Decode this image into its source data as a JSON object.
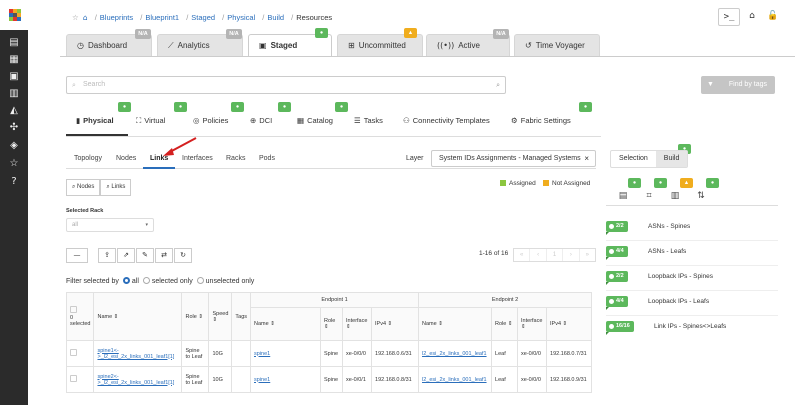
{
  "breadcrumb": [
    "Blueprints",
    "Blueprint1",
    "Staged",
    "Physical",
    "Build",
    "Resources"
  ],
  "top_buttons": {
    "terminal": ">_",
    "home": "⌂",
    "lock": "🔓"
  },
  "main_tabs": [
    {
      "label": "Dashboard",
      "icon": "dashboard-icon",
      "badge": "N/A"
    },
    {
      "label": "Analytics",
      "icon": "analytics-icon",
      "badge": "N/A"
    },
    {
      "label": "Staged",
      "icon": "staged-icon",
      "badge": "green"
    },
    {
      "label": "Uncommitted",
      "icon": "uncommitted-icon",
      "badge": "warning"
    },
    {
      "label": "Active",
      "icon": "active-icon",
      "badge": "N/A"
    },
    {
      "label": "Time Voyager",
      "icon": "time-voyager-icon"
    }
  ],
  "search": {
    "placeholder": "Search"
  },
  "find_by_tags": "Find by tags",
  "sub_tabs": [
    "Physical",
    "Virtual",
    "Policies",
    "DCI",
    "Catalog",
    "Tasks",
    "Connectivity Templates",
    "Fabric Settings"
  ],
  "third_tabs": [
    "Topology",
    "Nodes",
    "Links",
    "Interfaces",
    "Racks",
    "Pods"
  ],
  "layer": {
    "label": "Layer",
    "value": "System IDs Assignments - Managed Systems"
  },
  "nodes_links_buttons": [
    "Nodes",
    "Links"
  ],
  "legend": {
    "assigned": "Assigned",
    "not_assigned": "Not Assigned",
    "assigned_color": "#8cc63f",
    "not_assigned_color": "#f0ad1e"
  },
  "selected_rack": {
    "label": "Selected Rack",
    "value": "all"
  },
  "pagination": {
    "info": "1-16 of 16",
    "pages": [
      "«",
      "‹",
      "1",
      "›",
      "»"
    ]
  },
  "filter": {
    "label": "Filter selected by",
    "opt_all": "all",
    "opt_selected": "selected only",
    "opt_unselected": "unselected only"
  },
  "table": {
    "col_selected": "0 selected",
    "col_name": "Name ⇕",
    "col_role": "Role ⇕",
    "col_speed": "Speed ⇕",
    "col_tags": "Tags",
    "endpoint1": "Endpoint 1",
    "endpoint2": "Endpoint 2",
    "ep_name": "Name ⇕",
    "ep_role": "Role ⇕",
    "ep_interface": "Interface ⇕",
    "ep_ipv4": "IPv4 ⇕",
    "rows": [
      {
        "name": "spine1<->_l2_esi_2x_links_001_leaf1[1]",
        "role": "Spine to Leaf",
        "speed": "10G",
        "tags": "",
        "ep1_name": "spine1",
        "ep1_role": "Spine",
        "ep1_if": "xe-0/0/0",
        "ep1_ip": "192.168.0.6/31",
        "ep2_name": "l2_esi_2x_links_001_leaf1",
        "ep2_role": "Leaf",
        "ep2_if": "xe-0/0/0",
        "ep2_ip": "192.168.0.7/31"
      },
      {
        "name": "spine2<->_l2_esi_2x_links_001_leaf1[1]",
        "role": "Spine to Leaf",
        "speed": "10G",
        "tags": "",
        "ep1_name": "spine1",
        "ep1_role": "Spine",
        "ep1_if": "xe-0/0/1",
        "ep1_ip": "192.168.0.8/31",
        "ep2_name": "l2_esi_2x_links_001_leaf1",
        "ep2_role": "Leaf",
        "ep2_if": "xe-0/0/0",
        "ep2_ip": "192.168.0.9/31"
      }
    ]
  },
  "right_panel": {
    "tabs": [
      "Selection",
      "Build"
    ],
    "resources": [
      {
        "count": "2/2",
        "label": "ASNs - Spines"
      },
      {
        "count": "4/4",
        "label": "ASNs - Leafs"
      },
      {
        "count": "2/2",
        "label": "Loopback IPs - Spines"
      },
      {
        "count": "4/4",
        "label": "Loopback IPs - Leafs"
      },
      {
        "count": "16/16",
        "label": "Link IPs - Spines<>Leafs"
      }
    ]
  },
  "colors": {
    "accent": "#2a6ebb",
    "success": "#5cb85c",
    "warning": "#f0ad1e",
    "rail": "#2b2b2b"
  }
}
